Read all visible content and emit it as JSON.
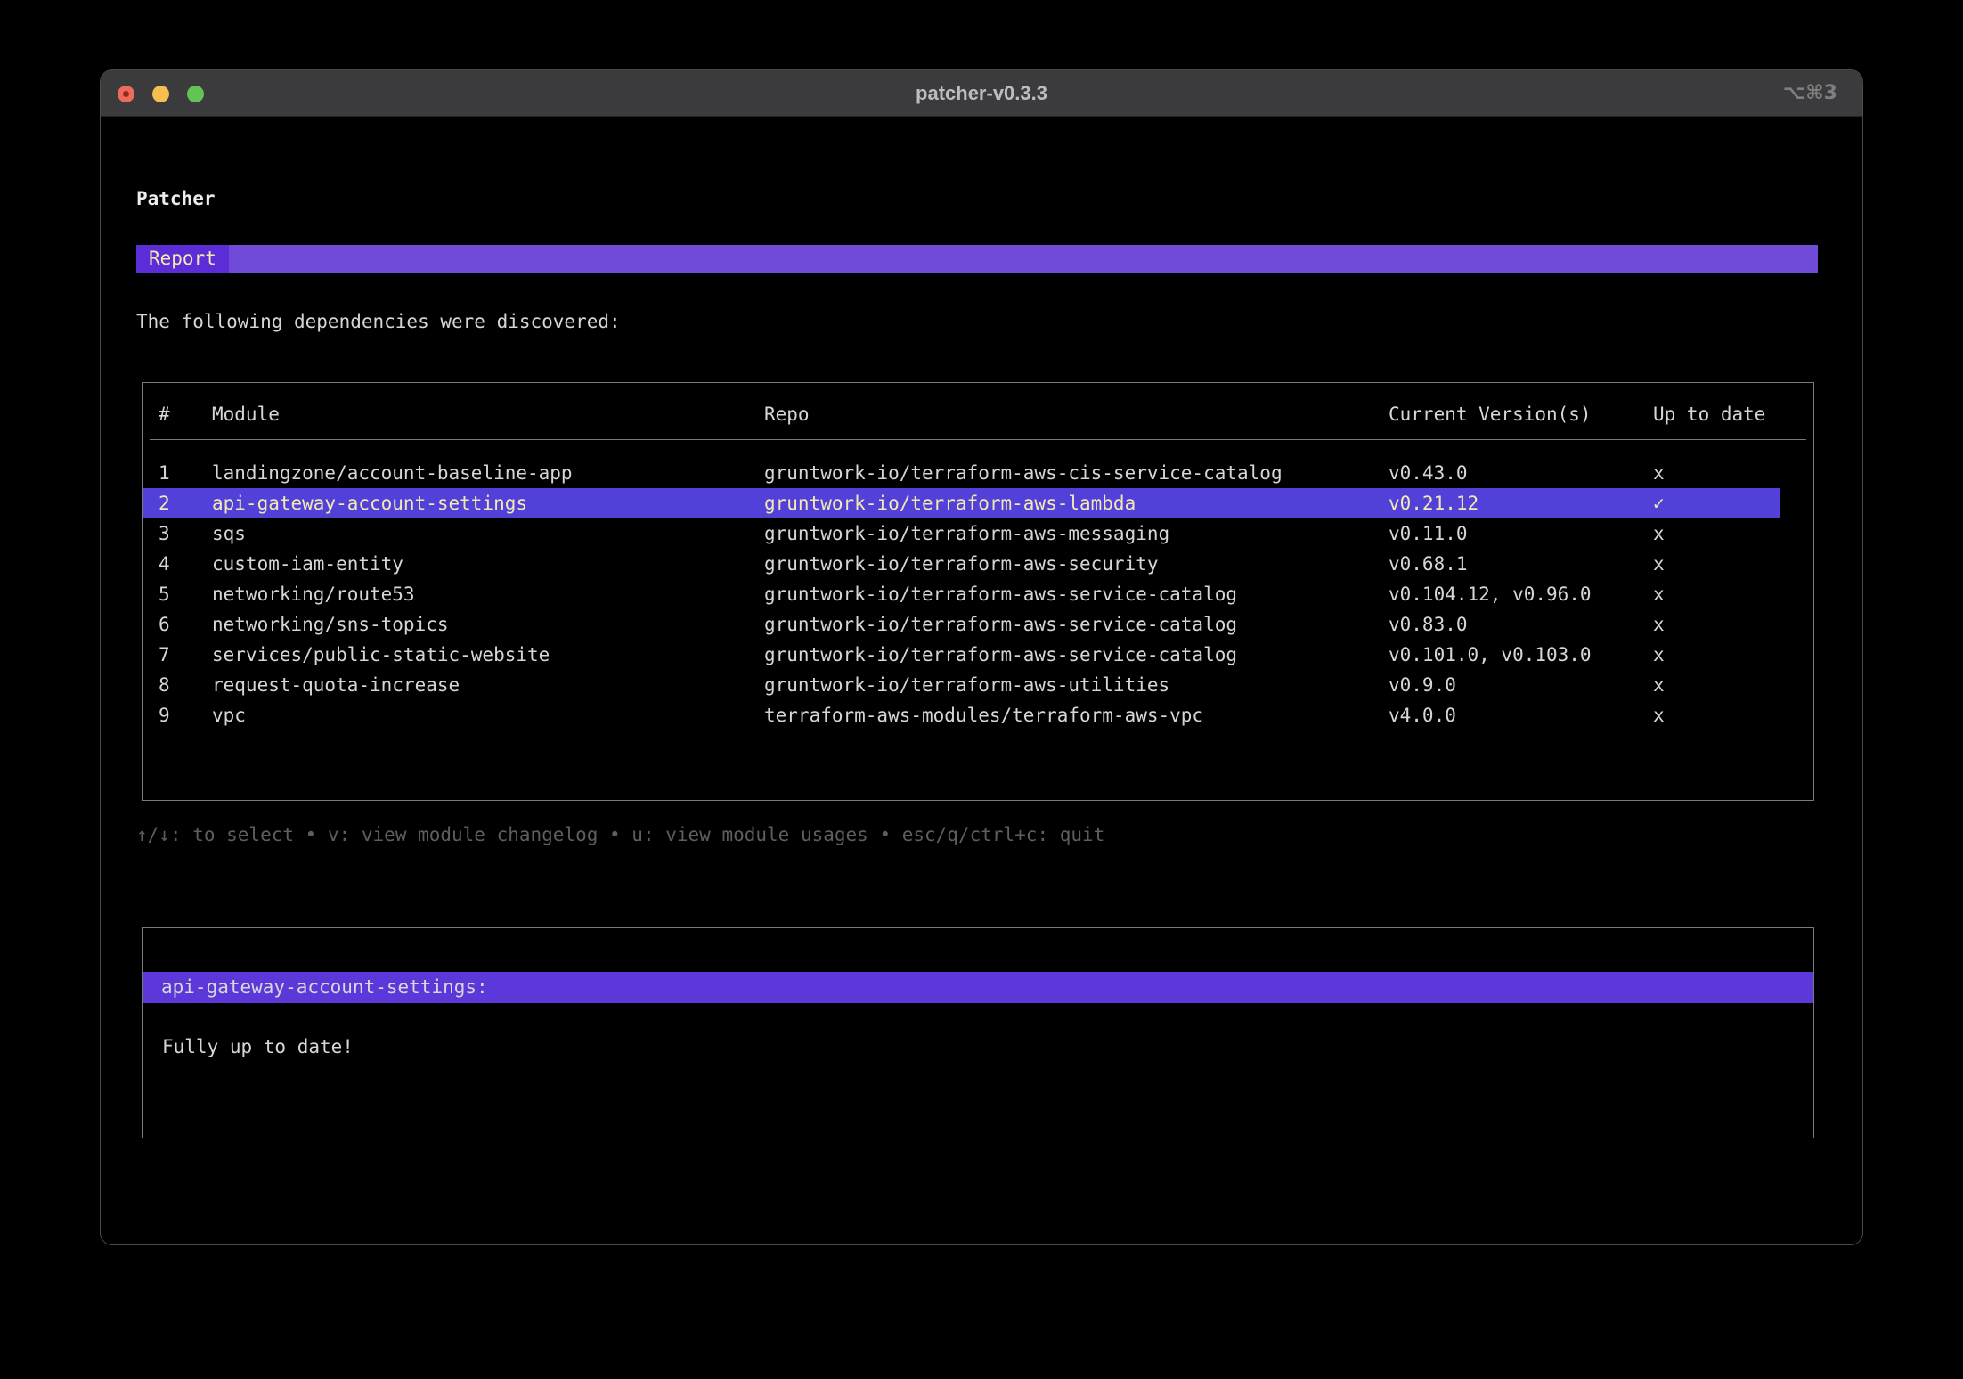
{
  "colors": {
    "accent-bar": "#6f4bd8",
    "accent-tab": "#5a2dd8",
    "accent-row": "#5141d9",
    "accent-panel": "#5c38da",
    "cream": "#f2e9b2",
    "text": "#d6d6d6",
    "dim": "#5e5e5e"
  },
  "titlebar": {
    "title": "patcher-v0.3.3",
    "shortcut": "⌥⌘3"
  },
  "page": {
    "heading": "Patcher",
    "tab": "Report",
    "intro": "The following dependencies were discovered:"
  },
  "table": {
    "headers": {
      "num": "#",
      "module": "Module",
      "repo": "Repo",
      "versions": "Current Version(s)",
      "up_to_date": "Up to date"
    },
    "rows": [
      {
        "num": "1",
        "module": "landingzone/account-baseline-app",
        "repo": "gruntwork-io/terraform-aws-cis-service-catalog",
        "versions": "v0.43.0",
        "up_to_date": "x",
        "selected": false
      },
      {
        "num": "2",
        "module": "api-gateway-account-settings",
        "repo": "gruntwork-io/terraform-aws-lambda",
        "versions": "v0.21.12",
        "up_to_date": "✓",
        "selected": true
      },
      {
        "num": "3",
        "module": "sqs",
        "repo": "gruntwork-io/terraform-aws-messaging",
        "versions": "v0.11.0",
        "up_to_date": "x",
        "selected": false
      },
      {
        "num": "4",
        "module": "custom-iam-entity",
        "repo": "gruntwork-io/terraform-aws-security",
        "versions": "v0.68.1",
        "up_to_date": "x",
        "selected": false
      },
      {
        "num": "5",
        "module": "networking/route53",
        "repo": "gruntwork-io/terraform-aws-service-catalog",
        "versions": "v0.104.12, v0.96.0",
        "up_to_date": "x",
        "selected": false
      },
      {
        "num": "6",
        "module": "networking/sns-topics",
        "repo": "gruntwork-io/terraform-aws-service-catalog",
        "versions": "v0.83.0",
        "up_to_date": "x",
        "selected": false
      },
      {
        "num": "7",
        "module": "services/public-static-website",
        "repo": "gruntwork-io/terraform-aws-service-catalog",
        "versions": "v0.101.0, v0.103.0",
        "up_to_date": "x",
        "selected": false
      },
      {
        "num": "8",
        "module": "request-quota-increase",
        "repo": "gruntwork-io/terraform-aws-utilities",
        "versions": "v0.9.0",
        "up_to_date": "x",
        "selected": false
      },
      {
        "num": "9",
        "module": "vpc",
        "repo": "terraform-aws-modules/terraform-aws-vpc",
        "versions": "v4.0.0",
        "up_to_date": "x",
        "selected": false
      }
    ]
  },
  "hints": {
    "text": "↑/↓: to select • v: view module changelog • u: view module usages • esc/q/ctrl+c: quit"
  },
  "detail": {
    "title": "api-gateway-account-settings:",
    "body": "Fully up to date!"
  }
}
